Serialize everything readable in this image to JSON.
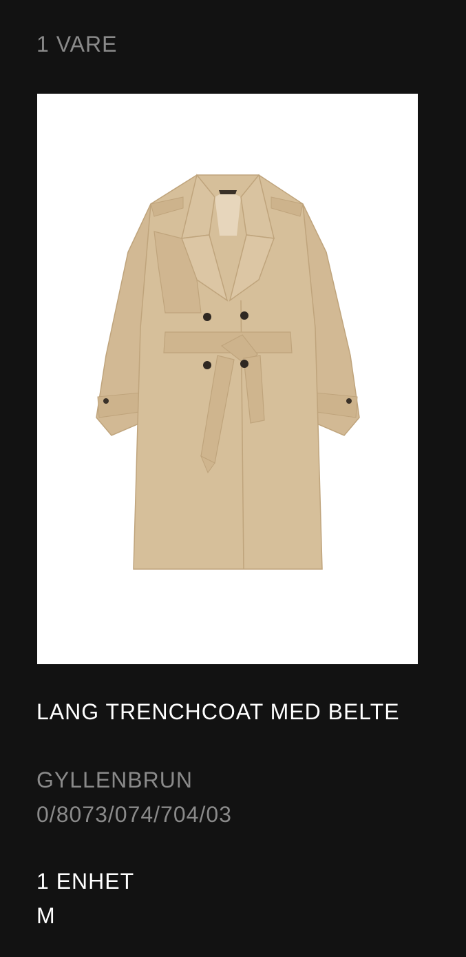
{
  "cart": {
    "item_count": "1 VARE"
  },
  "product": {
    "image_alt": "trench-coat",
    "name": "LANG TRENCHCOAT MED BELTE",
    "color": "GYLLENBRUN",
    "reference": "0/8073/074/704/03",
    "units": "1 ENHET",
    "size": "M"
  },
  "colors": {
    "background": "#121212",
    "text_primary": "#ffffff",
    "text_secondary": "#8a8a8a",
    "coat": "#d6bf9a"
  }
}
